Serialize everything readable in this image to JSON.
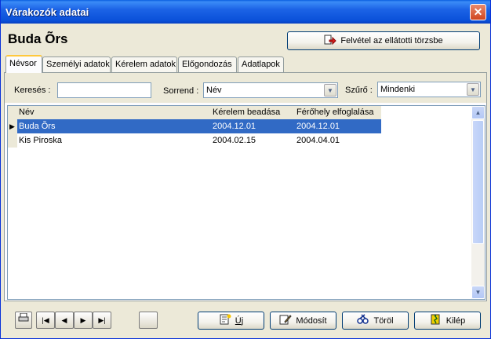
{
  "window": {
    "title": "Várakozók adatai",
    "close_symbol": "✕"
  },
  "person": {
    "name": "Buda Õrs"
  },
  "actions": {
    "register_label": "Felvétel az ellátotti törzsbe"
  },
  "tabs": [
    {
      "label": "Névsor",
      "active": true
    },
    {
      "label": "Személyi adatok"
    },
    {
      "label": "Kérelem adatok"
    },
    {
      "label": "Előgondozás"
    },
    {
      "label": "Adatlapok"
    }
  ],
  "filters": {
    "search_label": "Keresés :",
    "search_value": "",
    "order_label": "Sorrend :",
    "order_value": "Név",
    "filter_label": "Szűrő :",
    "filter_value": "Mindenki"
  },
  "table": {
    "columns": [
      "Név",
      "Kérelem beadása",
      "Férőhely elfoglalása"
    ],
    "rows": [
      {
        "name": "Buda Õrs",
        "requested": "2004.12.01",
        "occupied": "2004.12.01",
        "selected": true
      },
      {
        "name": "Kis Piroska",
        "requested": "2004.02.15",
        "occupied": "2004.04.01"
      }
    ],
    "row_marker": "▶"
  },
  "bottom": {
    "print_icon": "printer-icon",
    "nav": [
      "|◀",
      "◀",
      "▶",
      "▶|"
    ],
    "new_label": "Új",
    "edit_label": "Módosít",
    "delete_label": "Töröl",
    "exit_label": "Kilép"
  }
}
